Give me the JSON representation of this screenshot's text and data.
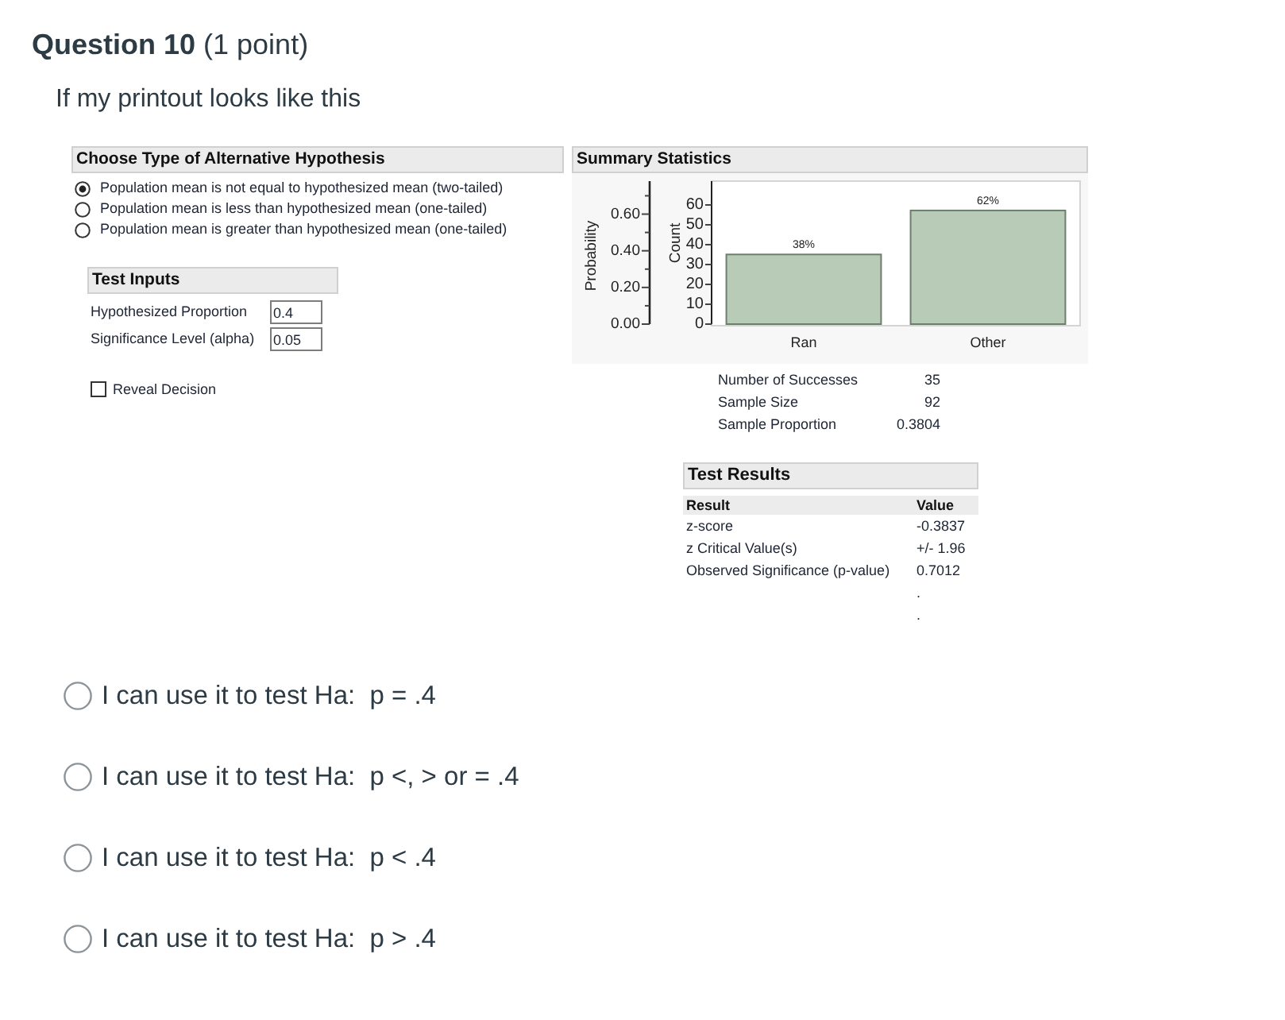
{
  "question": {
    "title": "**Question 10** (1 point)",
    "prompt": "If my printout looks like this"
  },
  "printout": {
    "hypothesis": {
      "heading": "Choose Type of Alternative Hypothesis",
      "options": [
        {
          "label": "Population mean is not equal to hypothesized mean (two-tailed)",
          "selected": true
        },
        {
          "label": "Population mean is less than hypothesized mean (one-tailed)",
          "selected": false
        },
        {
          "label": "Population mean is greater than hypothesized mean (one-tailed)",
          "selected": false
        }
      ]
    },
    "test_inputs": {
      "heading": "Test Inputs",
      "fields": [
        {
          "label": "Hypothesized Proportion",
          "value": "0.4"
        },
        {
          "label": "Significance Level (alpha)",
          "value": "0.05"
        }
      ]
    },
    "reveal_decision": {
      "label": "Reveal Decision",
      "checked": false
    },
    "summary_statistics": {
      "heading": "Summary Statistics",
      "chart_data": {
        "type": "bar",
        "ylabel": "Probability",
        "categories": [
          "Ran",
          "Other"
        ],
        "values": [
          0.38,
          0.62
        ],
        "ylim": [
          0,
          0.78
        ],
        "yticks": [
          {
            "value": 0,
            "label": "0.00"
          },
          {
            "value": 0.2,
            "label": "0.20"
          },
          {
            "value": 0.4,
            "label": "0.40"
          },
          {
            "value": 0.6,
            "label": "0.60"
          }
        ],
        "value_labels": [
          "38%",
          "62%"
        ]
      },
      "count_axis": {
        "label": "Count",
        "ticks": [
          "60",
          "50",
          "40",
          "30",
          "20",
          "10",
          "0"
        ]
      },
      "stats": [
        {
          "label": "Number of Successes",
          "value": "35"
        },
        {
          "label": "Sample Size",
          "value": "92"
        },
        {
          "label": "Sample Proportion",
          "value": "0.3804"
        }
      ]
    },
    "test_results": {
      "heading": "Test Results",
      "columns": [
        "Result",
        "Value"
      ],
      "rows": [
        {
          "result": "z-score",
          "value": "-0.3837"
        },
        {
          "result": "z Critical Value(s)",
          "value": "+/- 1.96"
        },
        {
          "result": "Observed Significance (p-value)",
          "value": "0.7012"
        }
      ],
      "trailing_marks": [
        ".",
        "."
      ]
    }
  },
  "answers": [
    {
      "label": "I can use it to test Ha:  p = .4",
      "selected": false
    },
    {
      "label": "I can use it to test Ha:  p <, > or = .4",
      "selected": false
    },
    {
      "label": "I can use it to test Ha:  p < .4",
      "selected": false
    },
    {
      "label": "I can use it to test Ha:  p > .4",
      "selected": false
    }
  ]
}
